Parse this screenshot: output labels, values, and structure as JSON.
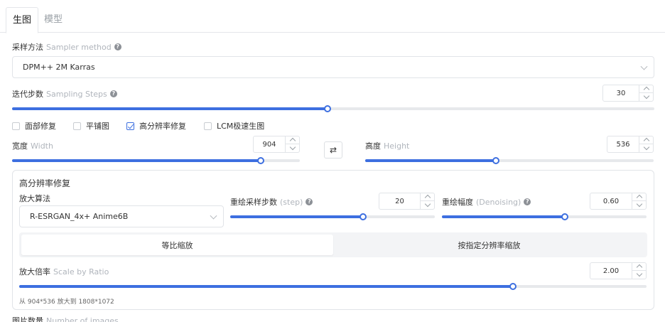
{
  "tabs": [
    {
      "label": "生图",
      "active": true
    },
    {
      "label": "模型",
      "active": false
    }
  ],
  "sampler": {
    "label": "采样方法",
    "label_en": "Sampler method",
    "value": "DPM++ 2M Karras"
  },
  "steps": {
    "label": "迭代步数",
    "label_en": "Sampling Steps",
    "value": "30",
    "slider_fraction": 0.491
  },
  "checkboxes": [
    {
      "label": "面部修复",
      "checked": false
    },
    {
      "label": "平铺图",
      "checked": false
    },
    {
      "label": "高分辨率修复",
      "checked": true
    },
    {
      "label": "LCM极速生图",
      "checked": false
    }
  ],
  "width": {
    "label": "宽度",
    "label_en": "Width",
    "value": "904",
    "slider_fraction": 0.863
  },
  "swap_icon": "swap-arrows-icon",
  "height": {
    "label": "高度",
    "label_en": "Height",
    "value": "536",
    "slider_fraction": 0.453
  },
  "hires": {
    "title": "高分辨率修复",
    "upscaler": {
      "label": "放大算法",
      "value": "R-ESRGAN_4x+ Anime6B"
    },
    "hires_steps": {
      "label": "重绘采样步数",
      "label_en": "(step)",
      "value": "20",
      "slider_fraction": 0.65
    },
    "denoising": {
      "label": "重绘幅度",
      "label_en": "(Denoising)",
      "value": "0.60",
      "slider_fraction": 0.6
    },
    "mode_tabs": [
      {
        "label": "等比缩放",
        "active": true
      },
      {
        "label": "按指定分辨率缩放",
        "active": false
      }
    ],
    "scale": {
      "label": "放大倍率",
      "label_en": "Scale by Ratio",
      "value": "2.00",
      "slider_fraction": 0.787
    },
    "note": "从 904*536 放大到 1808*1072"
  },
  "batch": {
    "label": "图片数量",
    "label_en": "Number of images"
  },
  "colors": {
    "accent": "#3d6fe0",
    "track": "#e7e9ec",
    "border": "#e1e4e8"
  }
}
